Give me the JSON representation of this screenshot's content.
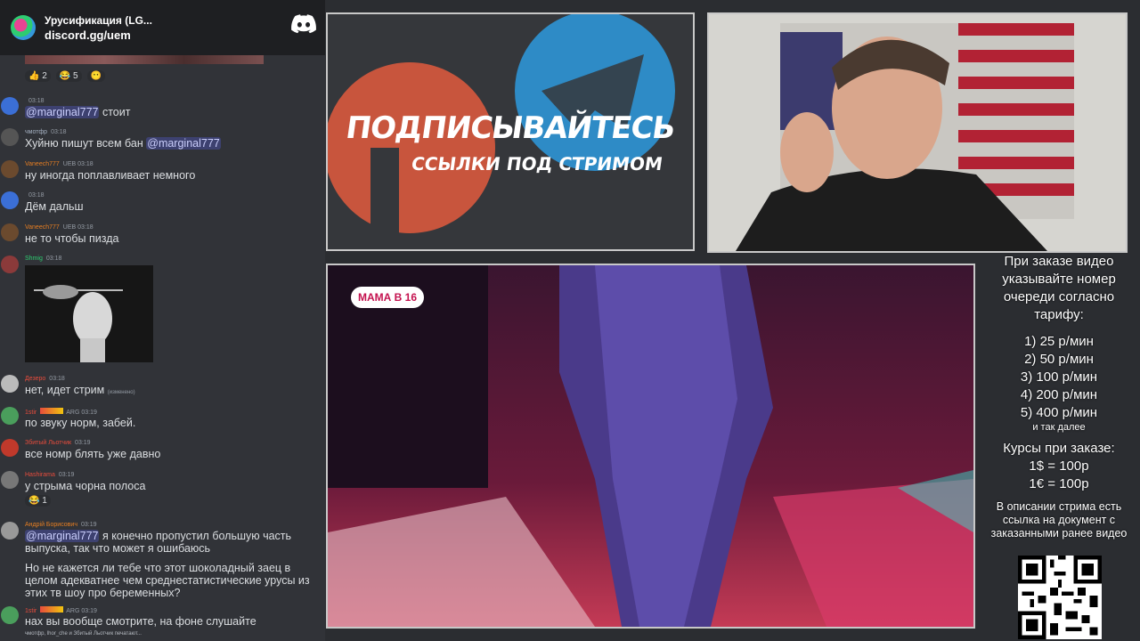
{
  "chat": {
    "server_name": "Урусификация (LG...",
    "invite": "discord.gg/uem",
    "reactions": [
      {
        "emoji": "👍",
        "count": "2"
      },
      {
        "emoji": "😂",
        "count": "5"
      },
      {
        "emoji": "😶",
        "count": ""
      }
    ],
    "messages": [
      {
        "user": "",
        "time": "03:18",
        "text_mention": "@marginal777",
        "text": " стоит"
      },
      {
        "user": "чмотфр",
        "time": "03:18",
        "text": "Хуйню пишут всем бан ",
        "text_mention": "@marginal777"
      },
      {
        "user": "Vaneech777",
        "badge": "UEB",
        "time": "03:18",
        "text": "ну иногда поплавливает немного"
      },
      {
        "user": "",
        "time": "03:18",
        "text": "Дём дальш"
      },
      {
        "user": "Vaneech777",
        "badge": "UEB",
        "time": "03:18",
        "text": "не то чтобы пизда"
      },
      {
        "user": "Shmig",
        "time": "03:18",
        "text": ""
      },
      {
        "user": "Дезеро",
        "time": "03:18",
        "text": "нет, идет стрим",
        "edited": "(изменено)"
      },
      {
        "user": "1stir",
        "badge": "ARG",
        "time": "03:19",
        "text": "по звуку норм, забей."
      },
      {
        "user": "Збитый Льотчик",
        "time": "03:19",
        "text": "все номр блять уже давно"
      },
      {
        "user": "Hashirama",
        "time": "03:19",
        "text": "у стрыма чорна полоса"
      },
      {
        "user": "Андрій Борисович",
        "time": "03:19",
        "text_mention": "@marginal777",
        "text": " я конечно пропустил большую часть выпуска, так что может я ошибаюсь",
        "text2": "Но не кажется ли тебе что этот шоколадный заец в целом адекватнее чем среднестатистические урусы из этих тв шоу про беременных?"
      },
      {
        "user": "1stir",
        "badge": "ARG",
        "time": "03:19",
        "text": "нах вы вообще смотрите, на фоне слушайте"
      }
    ],
    "hashirama_reaction": {
      "emoji": "😂",
      "count": "1"
    },
    "typing": "чмотфр, lhor_che и Збитый Льотчик печатают..."
  },
  "promo": {
    "title": "ПОДПИСЫВАЙТЕСЬ",
    "subtitle": "ССЫЛКИ ПОД СТРИМОМ"
  },
  "video": {
    "badge": "МАМА В 16"
  },
  "info": {
    "intro": "При заказе видео указывайте номер очереди согласно тарифу:",
    "tariffs": [
      "1) 25 р/мин",
      "2) 50 р/мин",
      "3) 100 р/мин",
      "4) 200 р/мин",
      "5) 400 р/мин"
    ],
    "and_more": "и так далее",
    "rates_title": "Курсы при заказе:",
    "rates": [
      "1$ = 100р",
      "1€ = 100р"
    ],
    "description": "В описании стрима есть ссылка на документ с заказанными ранее видео"
  },
  "colors": {
    "chat_bg": "#313338",
    "header_bg": "#1e1f22",
    "mention_bg": "#5865f2",
    "patreon": "#c8553d",
    "telegram": "#2e8bc6"
  }
}
